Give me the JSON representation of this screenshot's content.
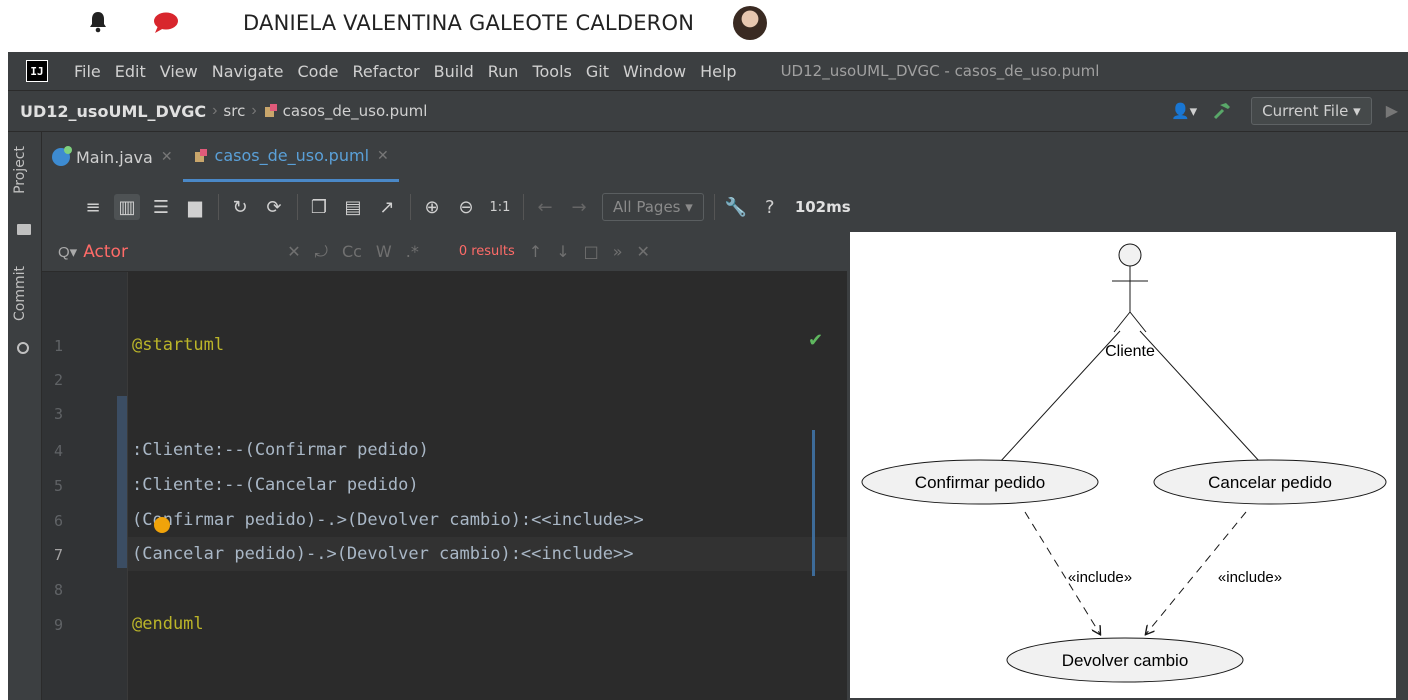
{
  "header": {
    "user_name": "DANIELA VALENTINA GALEOTE CALDERON",
    "bell_icon": "bell-icon",
    "chat_icon": "chat-icon"
  },
  "menu": {
    "items": [
      "File",
      "Edit",
      "View",
      "Navigate",
      "Code",
      "Refactor",
      "Build",
      "Run",
      "Tools",
      "Git",
      "Window",
      "Help"
    ],
    "window_title": "UD12_usoUML_DVGC - casos_de_uso.puml"
  },
  "nav": {
    "project": "UD12_usoUML_DVGC",
    "src": "src",
    "file": "casos_de_uso.puml",
    "run_config": "Current File"
  },
  "sidebar": {
    "project_label": "Project",
    "commit_label": "Commit"
  },
  "tabs": [
    {
      "label": "Main.java",
      "active": false
    },
    {
      "label": "casos_de_uso.puml",
      "active": true
    }
  ],
  "puml_toolbar": {
    "zoom_actual": "1:1",
    "pages": "All Pages",
    "help": "?",
    "timing": "102ms"
  },
  "search": {
    "query": "Actor",
    "results": "0 results",
    "match_case": "Cc",
    "words": "W",
    "regex": ".*"
  },
  "editor": {
    "lines": [
      {
        "n": "1",
        "text": "@startuml"
      },
      {
        "n": "2",
        "text": ""
      },
      {
        "n": "3",
        "text": ""
      },
      {
        "n": "4",
        "text": ":Cliente:--(Confirmar pedido)"
      },
      {
        "n": "5",
        "text": ":Cliente:--(Cancelar pedido)"
      },
      {
        "n": "6",
        "text": "(Confirmar pedido)-.>(Devolver cambio):<<include>>"
      },
      {
        "n": "7",
        "text": "(Cancelar pedido)-.>(Devolver cambio):<<include>>"
      },
      {
        "n": "8",
        "text": ""
      },
      {
        "n": "9",
        "text": "@enduml"
      }
    ],
    "current_line": "7"
  },
  "diagram": {
    "actor": "Cliente",
    "use_case_1": "Confirmar pedido",
    "use_case_2": "Cancelar pedido",
    "use_case_3": "Devolver cambio",
    "include_label_1": "«include»",
    "include_label_2": "«include»"
  }
}
